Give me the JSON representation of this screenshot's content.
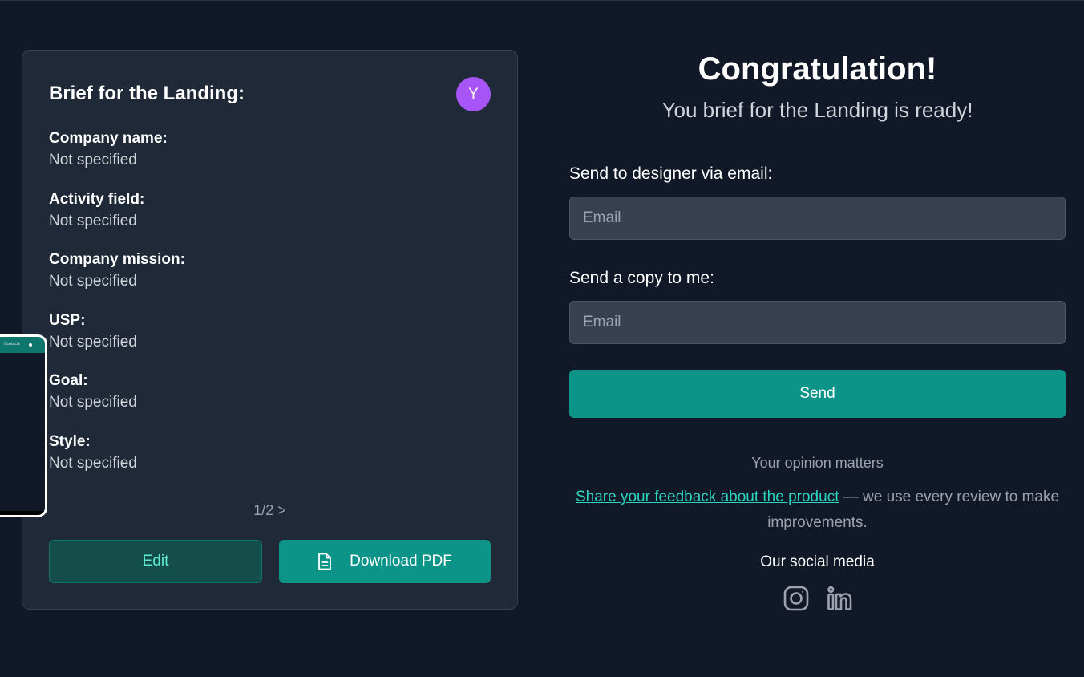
{
  "brief": {
    "title": "Brief for the Landing:",
    "avatar_letter": "Y",
    "fields": [
      {
        "label": "Company name:",
        "value": "Not specified"
      },
      {
        "label": "Activity field:",
        "value": "Not specified"
      },
      {
        "label": "Company mission:",
        "value": "Not specified"
      },
      {
        "label": "USP:",
        "value": "Not specified"
      },
      {
        "label": "Goal:",
        "value": "Not specified"
      },
      {
        "label": "Style:",
        "value": "Not specified"
      }
    ],
    "pager": "1/2 >",
    "edit_label": "Edit",
    "download_label": "Download PDF",
    "download_icon": "document-icon"
  },
  "phone_preview": {
    "bar_text": "Contacts"
  },
  "main": {
    "heading": "Congratulation!",
    "subheading": "You brief for the Landing is ready!",
    "designer_label": "Send to designer via email:",
    "designer_placeholder": "Email",
    "copy_label": "Send a copy to me:",
    "copy_placeholder": "Email",
    "send_label": "Send",
    "opinion": "Your opinion matters",
    "feedback_link": "Share your feedback about the product",
    "feedback_rest": " — we use every review to make improvements.",
    "social_title": "Our social media",
    "social_icons": [
      "instagram-icon",
      "linkedin-icon"
    ]
  },
  "colors": {
    "background": "#111827",
    "card": "#1f2937",
    "accent": "#0d9488",
    "avatar": "#a855f7",
    "link": "#2dd4bf"
  }
}
